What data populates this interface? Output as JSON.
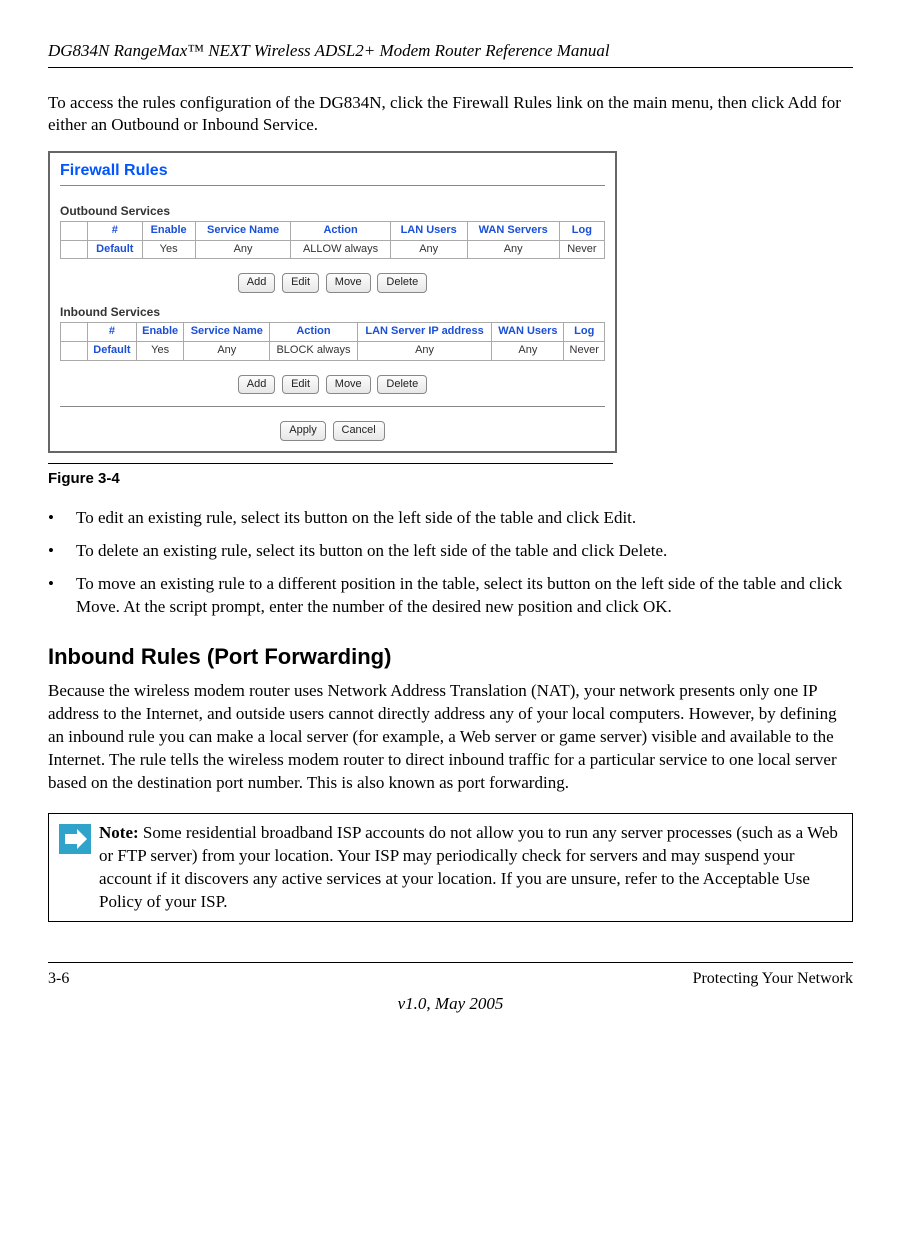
{
  "header": "DG834N RangeMax™ NEXT Wireless ADSL2+ Modem Router Reference Manual",
  "intro": "To access the rules configuration of the DG834N, click the Firewall Rules link on the main menu, then click Add for either an Outbound or Inbound Service.",
  "panel": {
    "title": "Firewall Rules",
    "outbound_label": "Outbound Services",
    "inbound_label": "Inbound Services",
    "out_headers": [
      "#",
      "Enable",
      "Service Name",
      "Action",
      "LAN Users",
      "WAN Servers",
      "Log"
    ],
    "out_row": [
      "Default",
      "Yes",
      "Any",
      "ALLOW always",
      "Any",
      "Any",
      "Never"
    ],
    "in_headers": [
      "#",
      "Enable",
      "Service Name",
      "Action",
      "LAN Server IP address",
      "WAN Users",
      "Log"
    ],
    "in_row": [
      "Default",
      "Yes",
      "Any",
      "BLOCK always",
      "Any",
      "Any",
      "Never"
    ],
    "crud": {
      "add": "Add",
      "edit": "Edit",
      "move": "Move",
      "delete": "Delete"
    },
    "apply": "Apply",
    "cancel": "Cancel"
  },
  "figure_label": "Figure 3-4",
  "bullets": [
    "To edit an existing rule, select its button on the left side of the table and click Edit.",
    "To delete an existing rule, select its button on the left side of the table and click Delete.",
    "To move an existing rule to a different position in the table, select its button on the left side of the table and click Move. At the script prompt, enter the number of the desired new position and click OK."
  ],
  "section_title": "Inbound Rules (Port Forwarding)",
  "section_body": "Because the wireless modem router uses Network Address Translation (NAT), your network presents only one IP address to the Internet, and outside users cannot directly address any of your local computers. However, by defining an inbound rule you can make a local server (for example, a Web server or game server) visible and available to the Internet. The rule tells the wireless modem router to direct inbound traffic for a particular service to one local server based on the destination port number. This is also known as port forwarding.",
  "note": {
    "label": "Note:",
    "body": " Some residential broadband ISP accounts do not allow you to run any server processes (such as a Web or FTP server) from your location. Your ISP may periodically check for servers and may suspend your account if it discovers any active services at your location. If you are unsure, refer to the Acceptable Use Policy of your ISP."
  },
  "footer": {
    "left": "3-6",
    "right": "Protecting Your Network",
    "center": "v1.0, May 2005"
  }
}
